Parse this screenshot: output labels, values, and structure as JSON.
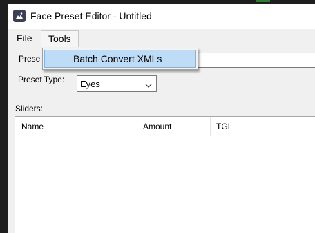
{
  "window": {
    "title": "Face Preset Editor - Untitled"
  },
  "menu": {
    "file_label": "File",
    "tools_label": "Tools",
    "tools_items": [
      "Batch Convert XMLs"
    ]
  },
  "form": {
    "preset_name_label": "Prese",
    "preset_name_value": "",
    "preset_type_label": "Preset Type:",
    "preset_type_value": "Eyes",
    "sliders_label": "Sliders:"
  },
  "sliders_table": {
    "columns": [
      "Name",
      "Amount",
      "TGI"
    ],
    "rows": []
  },
  "colors": {
    "highlight": "#bfdcf6",
    "highlight_border": "#7db3e6",
    "window_bg": "#f0f0f0"
  }
}
